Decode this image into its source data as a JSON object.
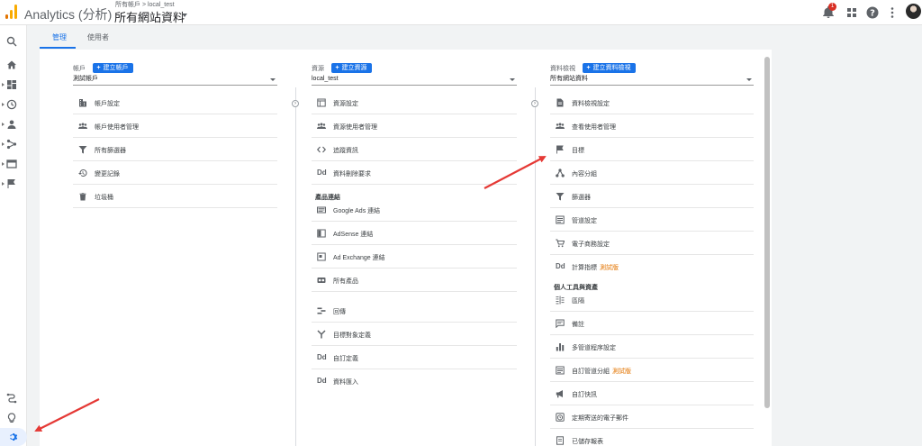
{
  "header": {
    "app_title": "Analytics (分析)",
    "breadcrumb": "所有帳戶 > local_test",
    "view_title": "所有網站資料",
    "notification_count": "1"
  },
  "tabs": [
    {
      "label": "管理"
    },
    {
      "label": "使用者"
    }
  ],
  "account": {
    "label": "帳戶",
    "create_label": "建立帳戶",
    "selected": "測試帳戶",
    "items": [
      {
        "label": "帳戶設定",
        "icon": "building-icon"
      },
      {
        "label": "帳戶使用者管理",
        "icon": "people-icon"
      },
      {
        "label": "所有篩選器",
        "icon": "filter-icon"
      },
      {
        "label": "變更記錄",
        "icon": "history-icon"
      },
      {
        "label": "垃圾桶",
        "icon": "trash-icon"
      }
    ]
  },
  "property": {
    "label": "資源",
    "create_label": "建立資源",
    "selected": "local_test",
    "items": [
      {
        "label": "資源設定",
        "icon": "window-icon"
      },
      {
        "label": "資源使用者管理",
        "icon": "people-icon"
      },
      {
        "label": "追蹤資訊",
        "icon": "code-icon"
      },
      {
        "label": "資料刪除要求",
        "icon": "dd-icon"
      }
    ],
    "product_section": "產品連結",
    "product_items": [
      {
        "label": "Google Ads 連結",
        "icon": "ads-icon"
      },
      {
        "label": "AdSense 連結",
        "icon": "adsense-icon"
      },
      {
        "label": "Ad Exchange 連結",
        "icon": "adexchange-icon"
      },
      {
        "label": "所有產品",
        "icon": "products-icon"
      }
    ],
    "other_items": [
      {
        "label": "回傳",
        "icon": "postback-icon"
      },
      {
        "label": "目標對象定義",
        "icon": "audience-icon"
      },
      {
        "label": "自訂定義",
        "icon": "dd-icon"
      },
      {
        "label": "資料匯入",
        "icon": "dd-icon"
      }
    ]
  },
  "view": {
    "label": "資料檢視",
    "create_label": "建立資料檢視",
    "selected": "所有網站資料",
    "items": [
      {
        "label": "資料檢視設定",
        "icon": "document-icon"
      },
      {
        "label": "查看使用者管理",
        "icon": "people-icon"
      },
      {
        "label": "目標",
        "icon": "flag-icon"
      },
      {
        "label": "內容分組",
        "icon": "grouping-icon"
      },
      {
        "label": "篩選器",
        "icon": "filter-icon"
      },
      {
        "label": "管道設定",
        "icon": "channel-icon"
      },
      {
        "label": "電子商務設定",
        "icon": "cart-icon"
      },
      {
        "label": "計算指標",
        "icon": "dd-icon",
        "beta": "測試版"
      }
    ],
    "personal_section": "個人工具與資產",
    "personal_items": [
      {
        "label": "區隔",
        "icon": "segment-icon"
      },
      {
        "label": "備註",
        "icon": "comment-icon"
      },
      {
        "label": "多管道程序設定",
        "icon": "bar-chart-icon"
      },
      {
        "label": "自訂管道分組",
        "icon": "channel-icon",
        "beta": "測試版"
      },
      {
        "label": "自訂快訊",
        "icon": "megaphone-icon"
      },
      {
        "label": "定期寄送的電子郵件",
        "icon": "clock-icon"
      },
      {
        "label": "已儲存報表",
        "icon": "saved-report-icon"
      }
    ]
  },
  "dd_text": "Dd",
  "colors": {
    "accent": "#1a73e8",
    "beta": "#e37400",
    "arrow": "#e53935"
  }
}
